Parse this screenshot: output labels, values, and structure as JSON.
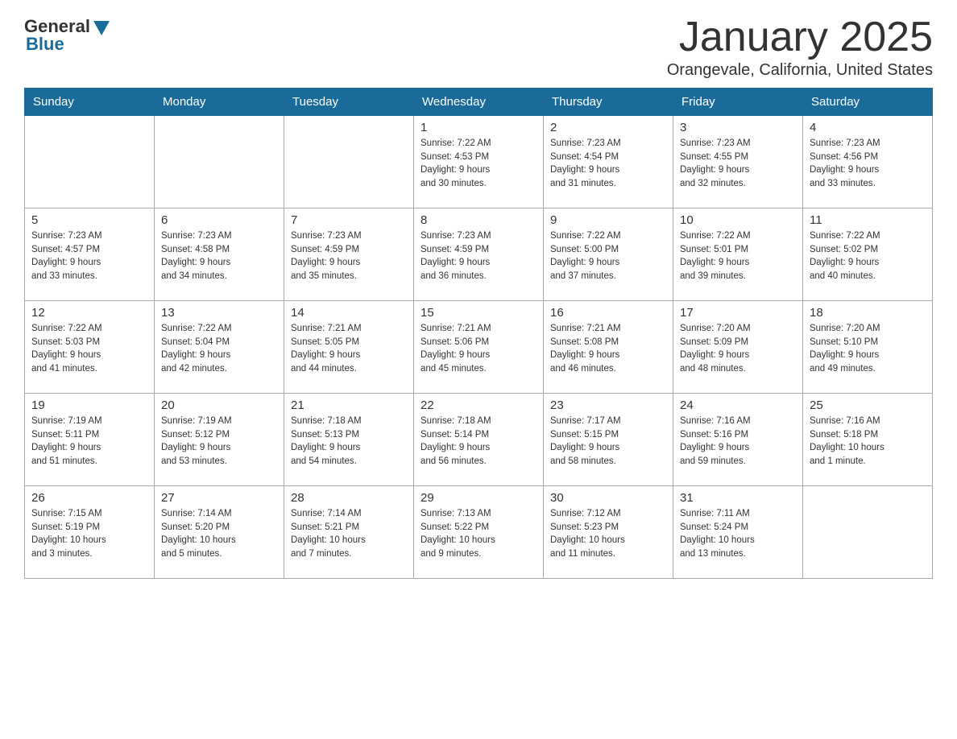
{
  "header": {
    "logo_general": "General",
    "logo_blue": "Blue",
    "month_title": "January 2025",
    "location": "Orangevale, California, United States"
  },
  "days_of_week": [
    "Sunday",
    "Monday",
    "Tuesday",
    "Wednesday",
    "Thursday",
    "Friday",
    "Saturday"
  ],
  "weeks": [
    [
      {
        "day": "",
        "info": ""
      },
      {
        "day": "",
        "info": ""
      },
      {
        "day": "",
        "info": ""
      },
      {
        "day": "1",
        "info": "Sunrise: 7:22 AM\nSunset: 4:53 PM\nDaylight: 9 hours\nand 30 minutes."
      },
      {
        "day": "2",
        "info": "Sunrise: 7:23 AM\nSunset: 4:54 PM\nDaylight: 9 hours\nand 31 minutes."
      },
      {
        "day": "3",
        "info": "Sunrise: 7:23 AM\nSunset: 4:55 PM\nDaylight: 9 hours\nand 32 minutes."
      },
      {
        "day": "4",
        "info": "Sunrise: 7:23 AM\nSunset: 4:56 PM\nDaylight: 9 hours\nand 33 minutes."
      }
    ],
    [
      {
        "day": "5",
        "info": "Sunrise: 7:23 AM\nSunset: 4:57 PM\nDaylight: 9 hours\nand 33 minutes."
      },
      {
        "day": "6",
        "info": "Sunrise: 7:23 AM\nSunset: 4:58 PM\nDaylight: 9 hours\nand 34 minutes."
      },
      {
        "day": "7",
        "info": "Sunrise: 7:23 AM\nSunset: 4:59 PM\nDaylight: 9 hours\nand 35 minutes."
      },
      {
        "day": "8",
        "info": "Sunrise: 7:23 AM\nSunset: 4:59 PM\nDaylight: 9 hours\nand 36 minutes."
      },
      {
        "day": "9",
        "info": "Sunrise: 7:22 AM\nSunset: 5:00 PM\nDaylight: 9 hours\nand 37 minutes."
      },
      {
        "day": "10",
        "info": "Sunrise: 7:22 AM\nSunset: 5:01 PM\nDaylight: 9 hours\nand 39 minutes."
      },
      {
        "day": "11",
        "info": "Sunrise: 7:22 AM\nSunset: 5:02 PM\nDaylight: 9 hours\nand 40 minutes."
      }
    ],
    [
      {
        "day": "12",
        "info": "Sunrise: 7:22 AM\nSunset: 5:03 PM\nDaylight: 9 hours\nand 41 minutes."
      },
      {
        "day": "13",
        "info": "Sunrise: 7:22 AM\nSunset: 5:04 PM\nDaylight: 9 hours\nand 42 minutes."
      },
      {
        "day": "14",
        "info": "Sunrise: 7:21 AM\nSunset: 5:05 PM\nDaylight: 9 hours\nand 44 minutes."
      },
      {
        "day": "15",
        "info": "Sunrise: 7:21 AM\nSunset: 5:06 PM\nDaylight: 9 hours\nand 45 minutes."
      },
      {
        "day": "16",
        "info": "Sunrise: 7:21 AM\nSunset: 5:08 PM\nDaylight: 9 hours\nand 46 minutes."
      },
      {
        "day": "17",
        "info": "Sunrise: 7:20 AM\nSunset: 5:09 PM\nDaylight: 9 hours\nand 48 minutes."
      },
      {
        "day": "18",
        "info": "Sunrise: 7:20 AM\nSunset: 5:10 PM\nDaylight: 9 hours\nand 49 minutes."
      }
    ],
    [
      {
        "day": "19",
        "info": "Sunrise: 7:19 AM\nSunset: 5:11 PM\nDaylight: 9 hours\nand 51 minutes."
      },
      {
        "day": "20",
        "info": "Sunrise: 7:19 AM\nSunset: 5:12 PM\nDaylight: 9 hours\nand 53 minutes."
      },
      {
        "day": "21",
        "info": "Sunrise: 7:18 AM\nSunset: 5:13 PM\nDaylight: 9 hours\nand 54 minutes."
      },
      {
        "day": "22",
        "info": "Sunrise: 7:18 AM\nSunset: 5:14 PM\nDaylight: 9 hours\nand 56 minutes."
      },
      {
        "day": "23",
        "info": "Sunrise: 7:17 AM\nSunset: 5:15 PM\nDaylight: 9 hours\nand 58 minutes."
      },
      {
        "day": "24",
        "info": "Sunrise: 7:16 AM\nSunset: 5:16 PM\nDaylight: 9 hours\nand 59 minutes."
      },
      {
        "day": "25",
        "info": "Sunrise: 7:16 AM\nSunset: 5:18 PM\nDaylight: 10 hours\nand 1 minute."
      }
    ],
    [
      {
        "day": "26",
        "info": "Sunrise: 7:15 AM\nSunset: 5:19 PM\nDaylight: 10 hours\nand 3 minutes."
      },
      {
        "day": "27",
        "info": "Sunrise: 7:14 AM\nSunset: 5:20 PM\nDaylight: 10 hours\nand 5 minutes."
      },
      {
        "day": "28",
        "info": "Sunrise: 7:14 AM\nSunset: 5:21 PM\nDaylight: 10 hours\nand 7 minutes."
      },
      {
        "day": "29",
        "info": "Sunrise: 7:13 AM\nSunset: 5:22 PM\nDaylight: 10 hours\nand 9 minutes."
      },
      {
        "day": "30",
        "info": "Sunrise: 7:12 AM\nSunset: 5:23 PM\nDaylight: 10 hours\nand 11 minutes."
      },
      {
        "day": "31",
        "info": "Sunrise: 7:11 AM\nSunset: 5:24 PM\nDaylight: 10 hours\nand 13 minutes."
      },
      {
        "day": "",
        "info": ""
      }
    ]
  ]
}
